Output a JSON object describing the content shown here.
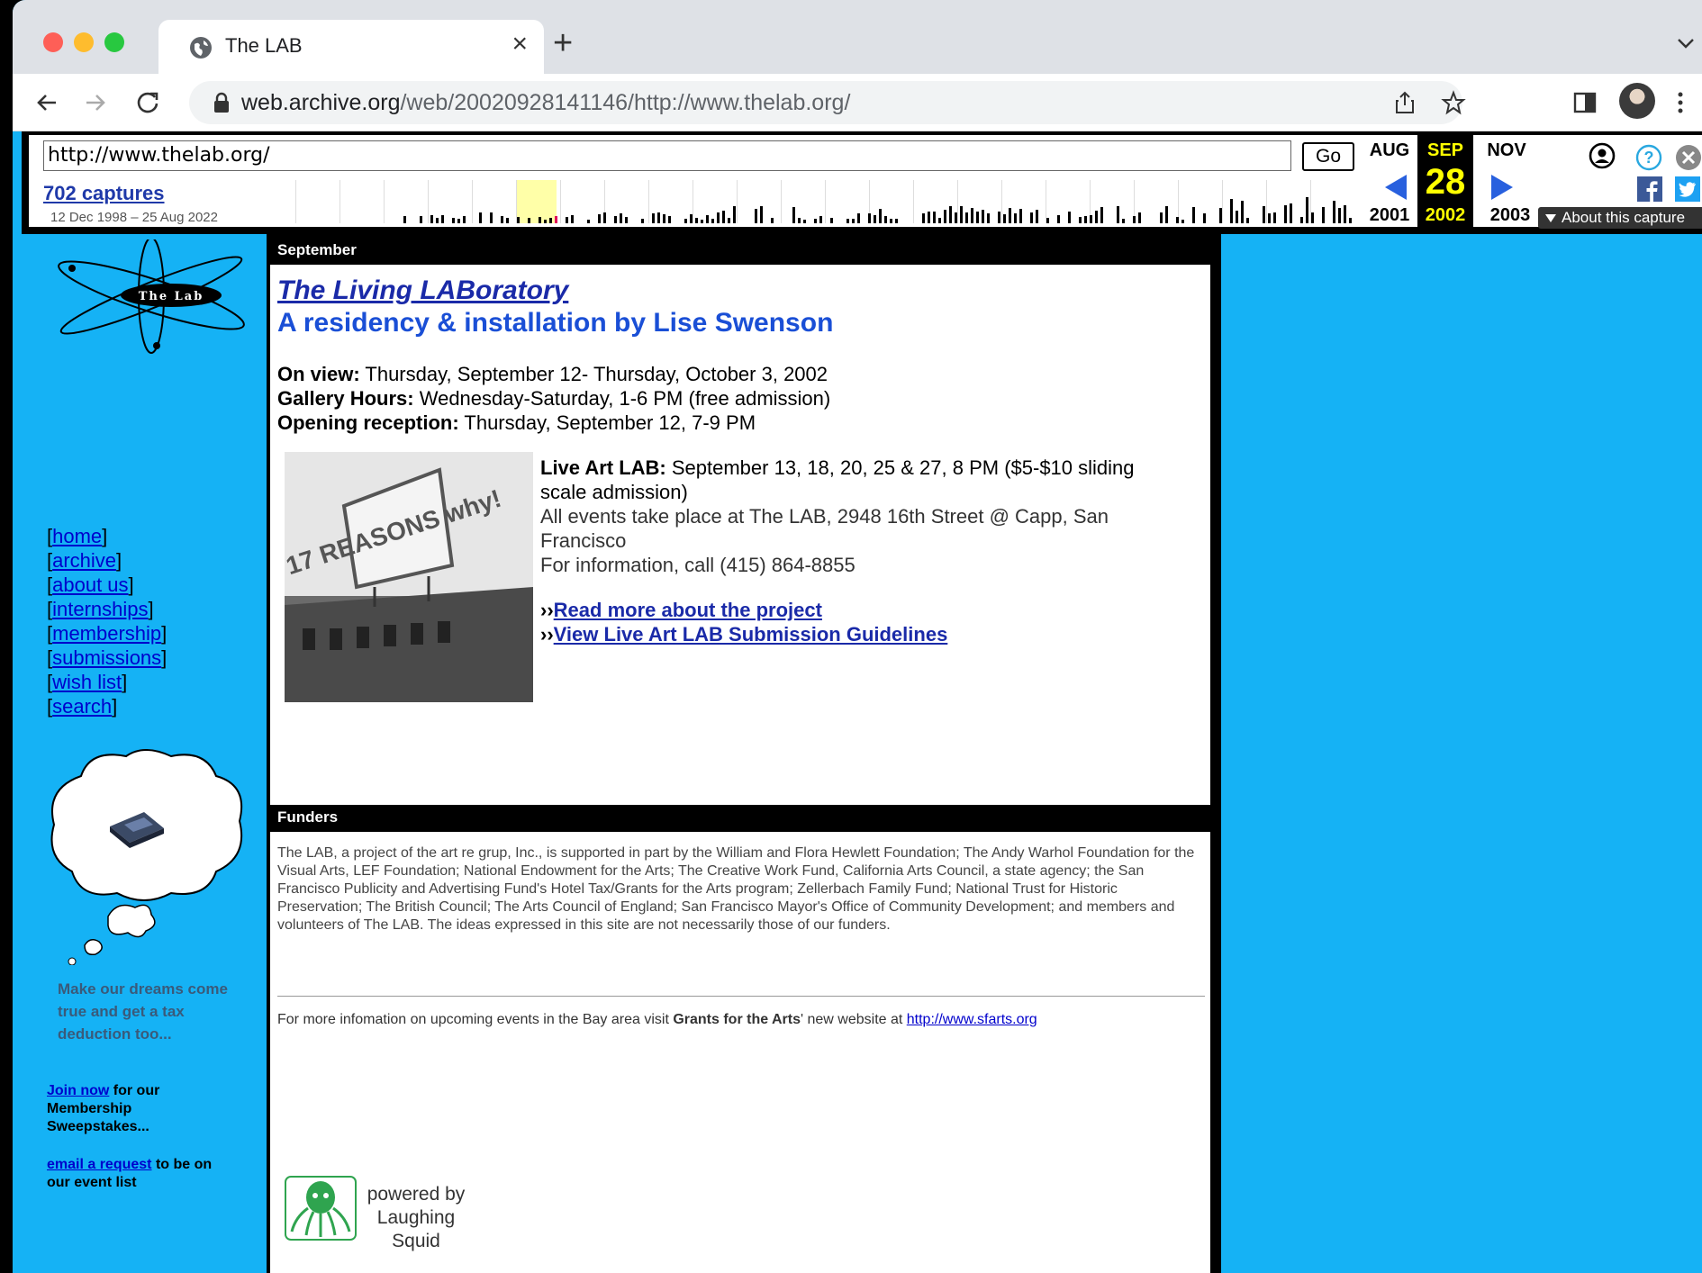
{
  "browser": {
    "tab_title": "The LAB",
    "tab_close": "×",
    "new_tab": "+",
    "url_host": "web.archive.org",
    "url_path": "/web/20020928141146/http://www.thelab.org/"
  },
  "wayback": {
    "url_value": "http://www.thelab.org/",
    "go_label": "Go",
    "captures": "702 captures",
    "range": "12 Dec 1998 – 25 Aug 2022",
    "prev_month": "AUG",
    "prev_year": "2001",
    "cur_month": "SEP",
    "cur_day": "28",
    "cur_year": "2002",
    "next_month": "NOV",
    "next_year": "2003",
    "about": "About this capture"
  },
  "sidebar": {
    "nav": [
      "home",
      "archive",
      "about us",
      "internships",
      "membership",
      "submissions",
      "wish list",
      "search"
    ],
    "dream": "Make our dreams come true and get a tax deduction too...",
    "join_link": "Join now",
    "join_text": " for our Membership Sweepstakes...",
    "email_link": "email a request",
    "email_text": " to be on our event list"
  },
  "main": {
    "section1": "September",
    "title": "The Living LABoratory",
    "subtitle": "A residency & installation by Lise Swenson",
    "on_view_label": "On view:",
    "on_view": " Thursday, September 12- Thursday, October 3, 2002",
    "hours_label": "Gallery Hours:",
    "hours": " Wednesday-Saturday, 1-6 PM (free admission)",
    "reception_label": "Opening reception:",
    "reception": " Thursday, September 12, 7-9 PM",
    "live_label": "Live Art LAB:",
    "live_text": " September 13, 18, 20, 25 & 27, 8 PM ($5-$10 sliding scale admission)",
    "events_line": "All events take place at The LAB, 2948 16th Street @ Capp, San Francisco",
    "info_line": "For information, call (415) 864-8855",
    "link1": "Read more about the project",
    "link2": "View Live Art LAB Submission Guidelines",
    "link_prefix": "››",
    "section2": "Funders",
    "funders_text": "The LAB, a project of the art re grup, Inc., is supported in part by the William and Flora Hewlett Foundation; The Andy Warhol Foundation for the Visual Arts, LEF Foundation; National Endowment for the Arts; The Creative Work Fund, California Arts Council, a state agency; the San Francisco Publicity and Advertising Fund's Hotel Tax/Grants for the Arts program; Zellerbach Family Fund; National Trust for Historic Preservation; The British Council; The Arts Council of England; San Francisco Mayor's Office of Community Development; and members and volunteers of The LAB. The ideas expressed in this site are not necessarily those of our funders.",
    "more_info_pre": "For more infomation on upcoming events in the Bay area visit ",
    "more_info_bold": "Grants for the Arts",
    "more_info_mid": "' new website at ",
    "more_info_link": "http://www.sfarts.org",
    "powered_by": "powered by",
    "squid": "Laughing Squid",
    "photo_sign": "17 REASONS why!",
    "logo_text": "The Lab"
  },
  "colors": {
    "page_bg": "#15b2f5",
    "link_blue": "#1a2aa8",
    "subtitle_blue": "#1a4fd6",
    "wayback_yellow": "#ffff00",
    "wayback_arrow": "#2860de"
  }
}
